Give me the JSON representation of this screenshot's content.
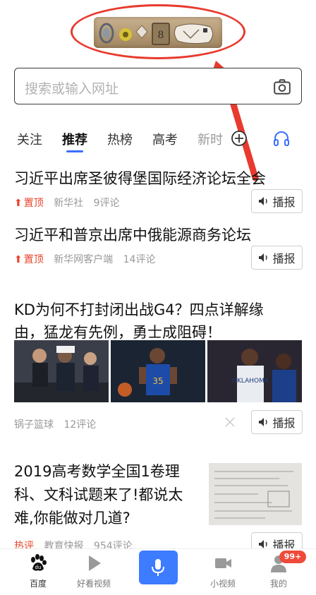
{
  "search": {
    "placeholder": "搜索或输入网址"
  },
  "tabs": [
    {
      "label": "关注"
    },
    {
      "label": "推荐"
    },
    {
      "label": "热榜"
    },
    {
      "label": "高考"
    },
    {
      "label": "新时"
    }
  ],
  "feed": {
    "item1": {
      "title": "习近平出席圣彼得堡国际经济论坛全会",
      "pin": "置顶",
      "source": "新华社",
      "comments": "9评论",
      "broadcast": "播报"
    },
    "item2": {
      "title": "习近平和普京出席中俄能源商务论坛",
      "pin": "置顶",
      "source": "新华网客户端",
      "comments": "14评论",
      "broadcast": "播报"
    },
    "item3": {
      "title_line1": "KD为何不打封闭出战G4？四点详解缘",
      "title_line2": "由，猛龙有先例，勇士成阻碍！",
      "source": "锅子篮球",
      "comments": "12评论",
      "broadcast": "播报"
    },
    "item4": {
      "title": "2019高考数学全国1卷理科、文科试题来了!都说太难,你能做对几道?",
      "tag": "热评",
      "source": "教育快报",
      "comments": "954评论",
      "broadcast": "播报"
    }
  },
  "bottom_nav": {
    "home": "百度",
    "video": "好看视频",
    "short_video": "小视频",
    "mine": "我的",
    "badge": "99+"
  },
  "colors": {
    "accent": "#3b6fff",
    "pin_red": "#e8452d",
    "annotation_red": "#e83a2e",
    "mic_blue": "#3d7bff"
  }
}
